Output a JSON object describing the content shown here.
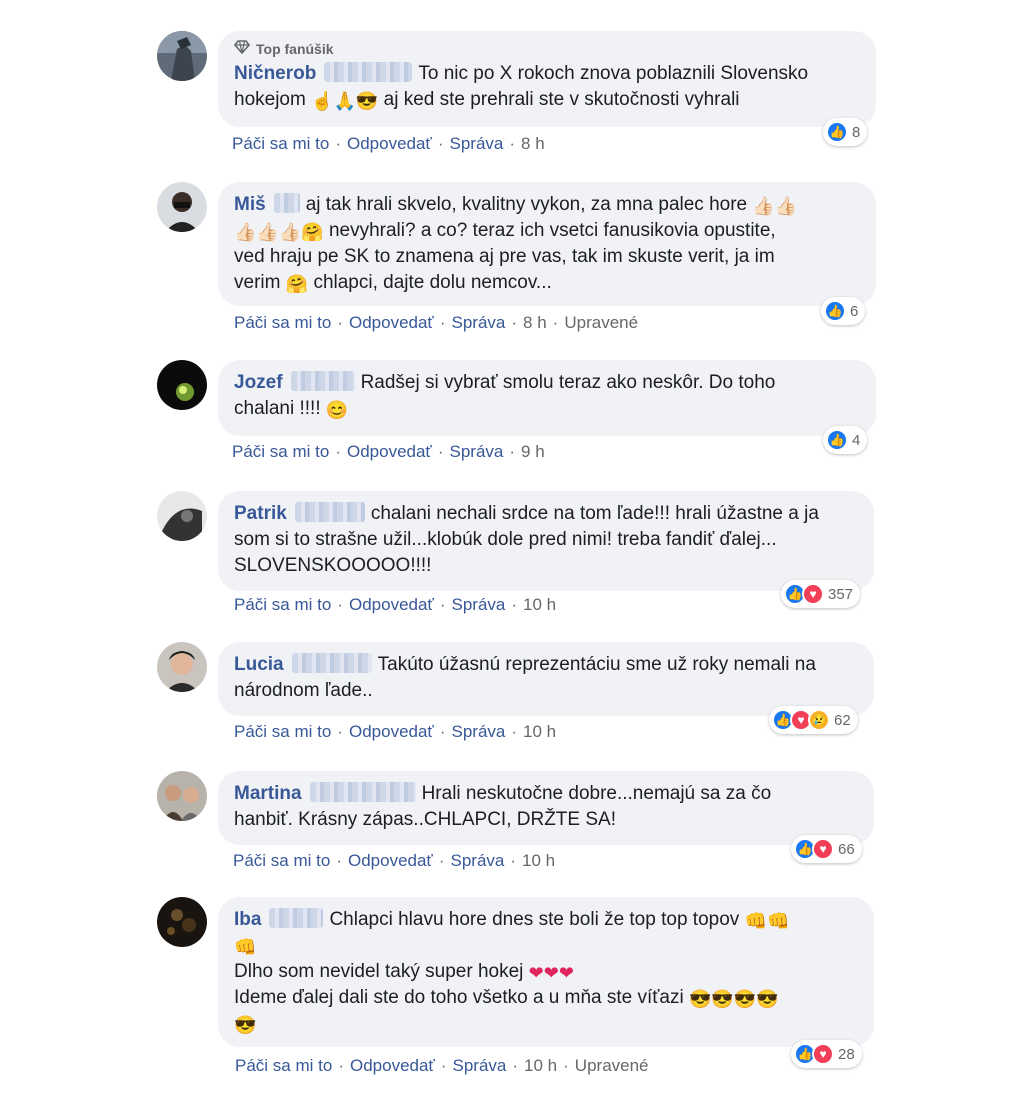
{
  "labels": {
    "like": "Páči sa mi to",
    "reply": "Odpovedať",
    "message": "Správa",
    "sep": "·",
    "edited": "Upravené",
    "top_fan": "Top fanúšik"
  },
  "comments": [
    {
      "author": "Ničnerob",
      "text1": "To nic po X rokoch znova poblaznili Slovensko",
      "text2a": "hokejom",
      "text2b": "aj ked ste prehrali ste v skutočnosti vyhrali",
      "time": "8 h",
      "reaction_count": "8"
    },
    {
      "author": "Miš",
      "text1": "aj tak hrali skvelo, kvalitny vykon, za mna palec hore",
      "text2": "nevyhrali? a co? teraz ich vsetci fanusikovia opustite,",
      "text3": "ved hraju pe SK to znamena aj pre vas, tak im skuste verit, ja im",
      "text4a": "verim",
      "text4b": "chlapci, dajte dolu nemcov...",
      "time": "8 h",
      "reaction_count": "6"
    },
    {
      "author": "Jozef",
      "text1": "Radšej si vybrať smolu teraz ako neskôr. Do toho",
      "text2": "chalani !!!!",
      "time": "9 h",
      "reaction_count": "4"
    },
    {
      "author": "Patrik",
      "text1": "chalani nechali srdce na tom ľade!!! hrali úžastne a ja",
      "text2": "som si to strašne užil...klobúk dole pred nimi! treba fandiť ďalej...",
      "text3": "SLOVENSKOOOOO!!!!",
      "time": "10 h",
      "reaction_count": "357"
    },
    {
      "author": "Lucia",
      "text1": "Takúto úžasnú reprezentáciu sme už roky nemali na",
      "text2": "národnom ľade..",
      "time": "10 h",
      "reaction_count": "62"
    },
    {
      "author": "Martina",
      "text1": "Hrali neskutočne dobre...nemajú sa za čo",
      "text2": "hanbiť. Krásny zápas..CHLAPCI, DRŽTE SA!",
      "time": "10 h",
      "reaction_count": "66"
    },
    {
      "author": "Iba",
      "text1": "Chlapci hlavu hore dnes ste boli že top top topov",
      "text3": "Dlho som nevidel taký super hokej",
      "text4": "Ideme ďalej dali ste do toho všetko a u mňa ste víťazi",
      "time": "10 h",
      "reaction_count": "28"
    }
  ],
  "colors": {
    "author": "#385898",
    "bubble": "#f0f2f5",
    "like": "#1877f2",
    "love": "#f33e58"
  }
}
